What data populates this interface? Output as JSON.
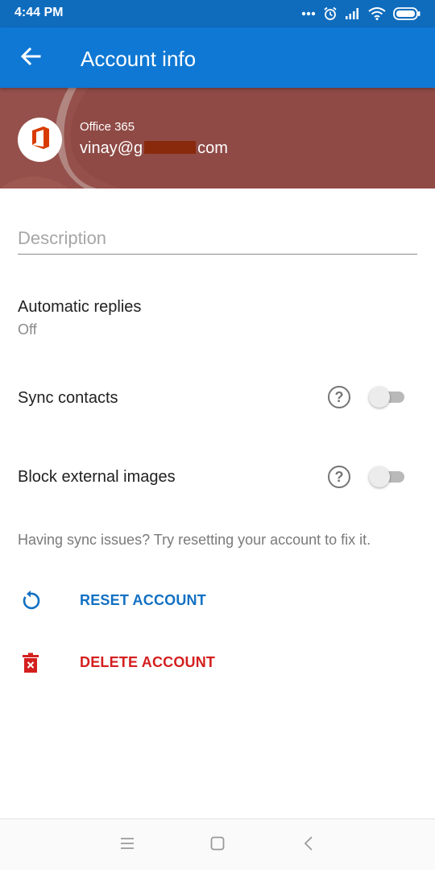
{
  "status_bar": {
    "time": "4:44 PM",
    "icons": [
      "more-dots-icon",
      "alarm-icon",
      "signal-icon",
      "wifi-icon",
      "battery-icon"
    ]
  },
  "app_bar": {
    "title": "Account info",
    "back_icon": "arrow-back-icon"
  },
  "account": {
    "type": "Office 365",
    "email_prefix": "vinay@g",
    "email_suffix": "com",
    "logo_icon": "office-logo-icon"
  },
  "description": {
    "placeholder": "Description",
    "value": ""
  },
  "settings": {
    "automatic_replies": {
      "title": "Automatic replies",
      "value": "Off"
    },
    "sync_contacts": {
      "title": "Sync contacts",
      "enabled": false
    },
    "block_external_images": {
      "title": "Block external images",
      "enabled": false
    },
    "help_glyph": "?"
  },
  "hint": "Having sync issues? Try resetting your account to fix it.",
  "actions": {
    "reset_label": "RESET ACCOUNT",
    "delete_label": "DELETE ACCOUNT"
  },
  "nav": {
    "icons": [
      "menu-icon",
      "home-square-icon",
      "back-chevron-icon"
    ]
  },
  "colors": {
    "status_bar": "#0f6cbd",
    "app_bar": "#0f78d4",
    "header_bg": "#8f4a45",
    "office_red": "#d83b01",
    "reset_blue": "#1270c2",
    "delete_red": "#d41f1f"
  }
}
